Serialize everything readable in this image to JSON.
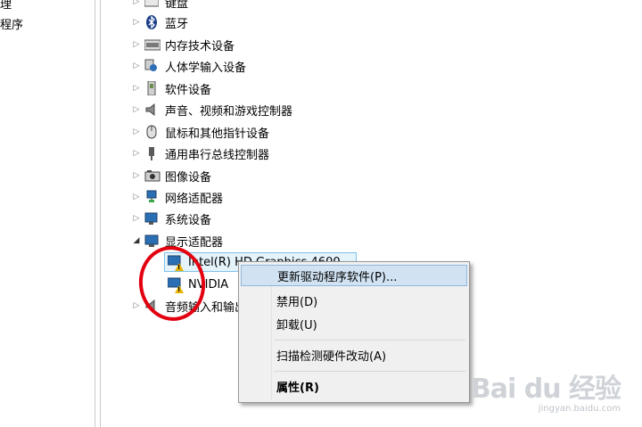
{
  "left_pane": {
    "items": [
      "理",
      "程序"
    ]
  },
  "tree": {
    "items": [
      {
        "label": "键盘",
        "expanded": false
      },
      {
        "label": "蓝牙",
        "expanded": false
      },
      {
        "label": "内存技术设备",
        "expanded": false
      },
      {
        "label": "人体学输入设备",
        "expanded": false
      },
      {
        "label": "软件设备",
        "expanded": false
      },
      {
        "label": "声音、视频和游戏控制器",
        "expanded": false
      },
      {
        "label": "鼠标和其他指针设备",
        "expanded": false
      },
      {
        "label": "通用串行总线控制器",
        "expanded": false
      },
      {
        "label": "图像设备",
        "expanded": false
      },
      {
        "label": "网络适配器",
        "expanded": false
      },
      {
        "label": "系统设备",
        "expanded": false
      },
      {
        "label": "显示适配器",
        "expanded": true
      },
      {
        "label": "音频输入和输出",
        "expanded": false
      }
    ],
    "display_children": [
      "Intel(R) HD Graphics 4600",
      "NVIDIA"
    ]
  },
  "context_menu": {
    "items": [
      "更新驱动程序软件(P)...",
      "禁用(D)",
      "卸载(U)",
      "扫描检测硬件改动(A)",
      "属性(R)"
    ]
  },
  "watermark": {
    "logo": "Bai du 经验",
    "sub": "jingyan.baidu.com"
  },
  "colors": {
    "highlight": "#d1e3f3",
    "selection_border": "#7dc2ea",
    "annotation": "#e3000f"
  }
}
